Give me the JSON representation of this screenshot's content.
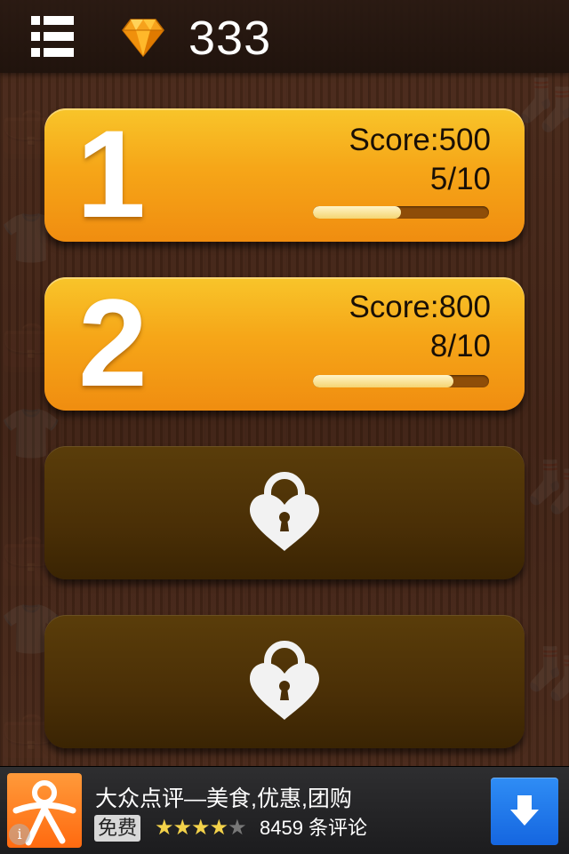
{
  "header": {
    "gem_count": "333"
  },
  "levels": [
    {
      "number": "1",
      "score": "Score:500",
      "progress": "5/10",
      "progress_fraction": 0.5
    },
    {
      "number": "2",
      "score": "Score:800",
      "progress": "8/10",
      "progress_fraction": 0.8
    },
    {
      "locked": true
    },
    {
      "locked": true
    }
  ],
  "ad": {
    "title": "大众点评—美食,优惠,团购",
    "badge": "免费",
    "rating": 4,
    "rating_max": 5,
    "reviews": "8459 条评论",
    "info_label": "i"
  },
  "colors": {
    "card_unlocked": "#f6a618",
    "card_locked": "#4a2f06",
    "progress_fill": "#f5d572",
    "ad_download": "#1566e0"
  },
  "icons": [
    "menu-icon",
    "diamond-icon",
    "heart-lock-icon",
    "download-arrow-icon",
    "dianping-logo-icon",
    "info-icon"
  ]
}
